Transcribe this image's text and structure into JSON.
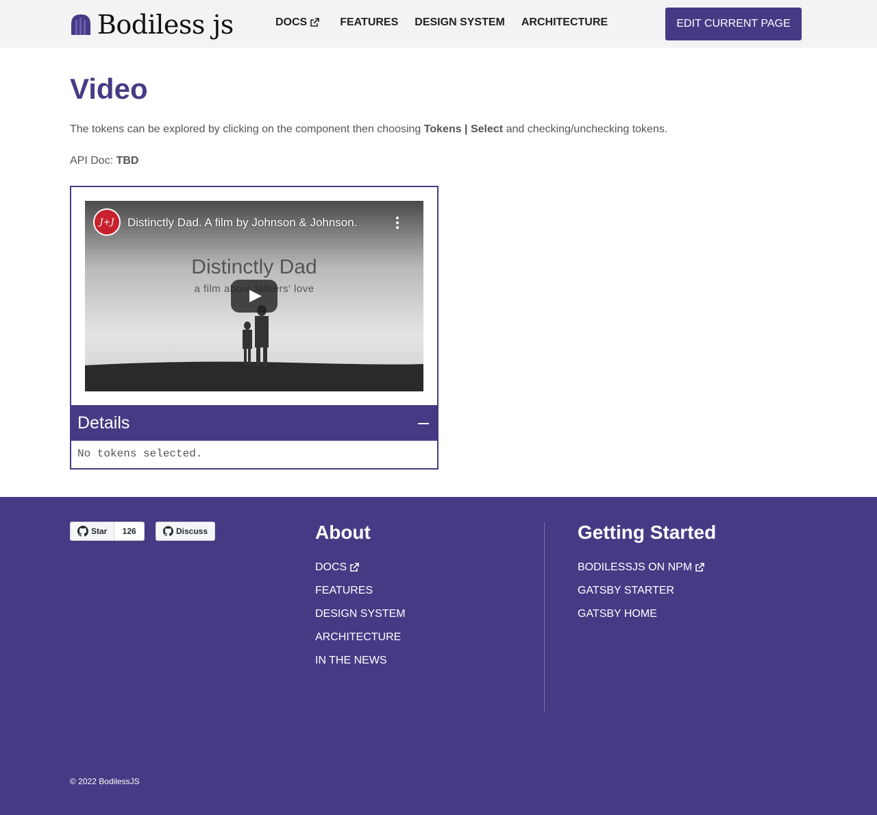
{
  "header": {
    "logo_text": "Bodiless js",
    "nav": [
      {
        "label": "DOCS",
        "external": true
      },
      {
        "label": "FEATURES"
      },
      {
        "label": "DESIGN SYSTEM"
      },
      {
        "label": "ARCHITECTURE"
      }
    ],
    "edit_button": "EDIT CURRENT PAGE"
  },
  "main": {
    "title": "Video",
    "intro_before": "The tokens can be explored by clicking on  the component then choosing ",
    "intro_bold": "Tokens | Select",
    "intro_after": " and checking/unchecking tokens.",
    "api_label": "API Doc: ",
    "api_value": "TBD",
    "video": {
      "channel_badge": "J+J",
      "title": "Distinctly Dad. A film by Johnson & Johnson.",
      "poster_title": "Distinctly Dad",
      "poster_subtitle": "a film about fathers' love"
    },
    "details": {
      "title": "Details",
      "body": "No tokens selected."
    }
  },
  "footer": {
    "github_star": "Star",
    "github_star_count": "126",
    "github_discuss": "Discuss",
    "about_heading": "About",
    "about_links": [
      "DOCS",
      "FEATURES",
      "DESIGN SYSTEM",
      "ARCHITECTURE",
      "IN THE NEWS"
    ],
    "getting_started_heading": "Getting Started",
    "getting_started_links": [
      "BODILESSJS ON NPM",
      "GATSBY STARTER",
      "GATSBY HOME"
    ],
    "copyright": "©  2022 BodilessJS"
  },
  "colors": {
    "brand": "#473a85",
    "header_bg": "#f3f3f3"
  }
}
